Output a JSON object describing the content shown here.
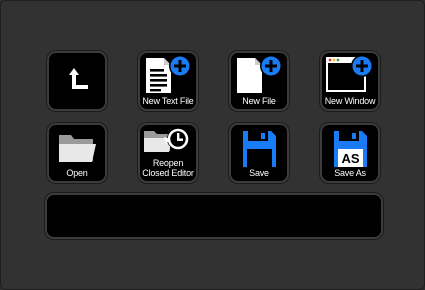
{
  "keys": {
    "back": {
      "label": "",
      "icon": "back-arrow-icon"
    },
    "new_text_file": {
      "label": "New Text File",
      "icon": "text-file-plus-icon"
    },
    "new_file": {
      "label": "New File",
      "icon": "file-plus-icon"
    },
    "new_window": {
      "label": "New Window",
      "icon": "window-plus-icon"
    },
    "open": {
      "label": "Open",
      "icon": "folder-icon"
    },
    "reopen_closed_editor": {
      "label": "Reopen\nClosed Editor",
      "icon": "folder-history-icon"
    },
    "save": {
      "label": "Save",
      "icon": "floppy-disk-icon"
    },
    "save_as": {
      "label": "Save As",
      "icon": "floppy-disk-as-icon",
      "badge": "AS"
    }
  },
  "display": {
    "text": ""
  },
  "colors": {
    "accent_blue": "#1a7cf5",
    "key_background": "#000000",
    "panel_background": "#323232"
  }
}
